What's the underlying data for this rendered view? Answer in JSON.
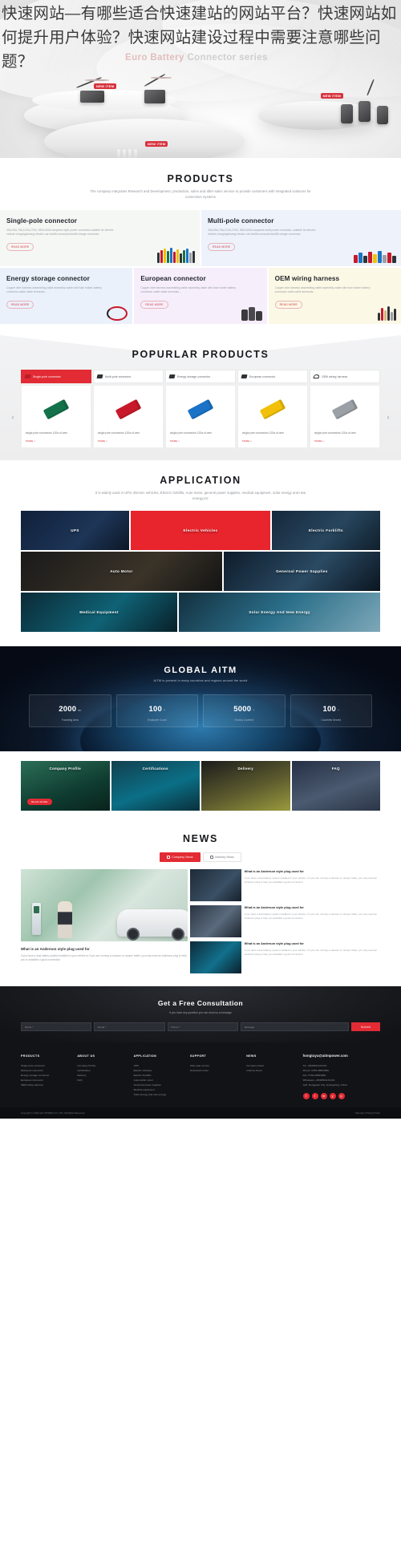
{
  "article": {
    "title": "快速网站—有哪些适合快速建站的网站平台？快速网站如何提升用户体验？快速网站建设过程中需要注意哪些问题？"
  },
  "hero": {
    "watermark_red": "Euro Battery",
    "watermark_grey": "Connector series",
    "tags": [
      "NEW ITEM",
      "NEW ITEM",
      "NEW ITEM",
      "NEW ITEM"
    ]
  },
  "products": {
    "title": "PRODUCTS",
    "subtitle": "The company integrates Research and Development, production, sales and after-sales service to provide customers with integrated solutions for connection systems",
    "cards": [
      {
        "title": "Single-pole connector",
        "desc": "30A,50A,75A,120A,175A, 350A,600A amperes style power connector suitable for electric vehicle charging/towing electric car forklift connector/forklift charge connector.",
        "button": "READ MORE",
        "bg": "#f5f7f4"
      },
      {
        "title": "Multi-pole connector",
        "desc": "30A,50A,75A,120A,175A, 350A,600A amperes multi power connector, suitable for electric vehicle charging/towing electric car forklift connector/forklift charge connector.",
        "button": "READ MORE",
        "bg": "#eef2fb"
      },
      {
        "title": "Energy storage connector",
        "desc": "Copper wire harness assembling cable assembly cable with fuse holder battery connector cable cable terminals...",
        "button": "READ MORE",
        "bg": "#eaf1fb"
      },
      {
        "title": "European connector",
        "desc": "Copper wire harness assembling cable assembly cable with fuse holder battery connector cable cable terminals...",
        "button": "READ MORE",
        "bg": "#f6eefb"
      },
      {
        "title": "OEM wiring harness",
        "desc": "Copper wire harness assembling cable assembly cable with fuse holder battery connector cable cable terminals...",
        "button": "READ MORE",
        "bg": "#fcf8e6"
      }
    ]
  },
  "popular": {
    "title": "POPURLAR PRODUCTS",
    "tabs": [
      {
        "label": "Single-pole connector",
        "active": true
      },
      {
        "label": "Multi-pole connector",
        "active": false
      },
      {
        "label": "Energy storage connector",
        "active": false
      },
      {
        "label": "European connector",
        "active": false
      },
      {
        "label": "OEM wiring harness",
        "active": false
      }
    ],
    "items": [
      {
        "caption": "single pole connectors 120a of oem",
        "more": "MORE >",
        "color": "#14724a"
      },
      {
        "caption": "single pole connectors 120a of oem",
        "more": "MORE >",
        "color": "#c8192a"
      },
      {
        "caption": "single pole connectors 120a of oem",
        "more": "MORE >",
        "color": "#1b73c7"
      },
      {
        "caption": "single pole connectors 120a of oem",
        "more": "MORE >",
        "color": "#f2c008"
      },
      {
        "caption": "single pole connectors 120a of oem",
        "more": "MORE >",
        "color": "#9aa0a6"
      }
    ],
    "prev_icon": "chevron-left",
    "next_icon": "chevron-right"
  },
  "application": {
    "title": "APPLICATION",
    "subtitle": "It is widely used in UPS, Electric vehicles, Electric forklifts, Auto motor, general power supplies, medical equipment, solar energy and new energy,etc",
    "tiles": [
      {
        "label": "UPS"
      },
      {
        "label": "Electric Vehicles"
      },
      {
        "label": "Electric Forklifts"
      },
      {
        "label": "Auto Motor"
      },
      {
        "label": "Genernal Power Supplies"
      },
      {
        "label": "Medical Equipment"
      },
      {
        "label": "Solar Energy And New Energy"
      }
    ]
  },
  "global": {
    "title": "GLOBAL AITM",
    "subtitle": "AITM is present in many countries and regions around the world",
    "stats": [
      {
        "num": "2000",
        "unit": "m²",
        "label": "Founding Area"
      },
      {
        "num": "100",
        "unit": "+",
        "label": "Employee Count"
      },
      {
        "num": "5000",
        "unit": "+",
        "label": "Factory Covered"
      },
      {
        "num": "100",
        "unit": "+",
        "label": "Countries Served"
      }
    ]
  },
  "about": {
    "cards": [
      {
        "label": "Company Profile",
        "button": "READ MORE"
      },
      {
        "label": "Certifications",
        "button": ""
      },
      {
        "label": "Delivery",
        "button": ""
      },
      {
        "label": "FAQ",
        "button": ""
      }
    ]
  },
  "news": {
    "title": "NEWS",
    "tabs": [
      {
        "label": "Company News",
        "active": true
      },
      {
        "label": "Industry News",
        "active": false
      }
    ],
    "feature": {
      "title": "What is an Anderson style plug used for",
      "desc": "If you have a dual battery system installed in your vehicle or if you are running a caravan or camper trailer, you may need an Anderson plug to help you to establish a good connection."
    },
    "items": [
      {
        "title": "What is an Anderson style plug used for",
        "desc": "If you have a dual battery system installed in your vehicle, or if you are running a caravan or camper trailer, you may need an Anderson plug to help you establish a good connection."
      },
      {
        "title": "What is an Anderson style plug used for",
        "desc": "If you have a dual battery system installed in your vehicle, or if you are running a caravan or camper trailer, you may need an Anderson plug to help you establish a good connection."
      },
      {
        "title": "What is an Anderson style plug used for",
        "desc": "If you have a dual battery system installed in your vehicle, or if you are running a caravan or camper trailer, you may need an Anderson plug to help you establish a good connection."
      }
    ]
  },
  "consult": {
    "title": "Get a Free Consultation",
    "subtitle": "If you have any question you can send us a message",
    "fields": [
      {
        "placeholder": "Name *"
      },
      {
        "placeholder": "Email *"
      },
      {
        "placeholder": "Phone *"
      },
      {
        "placeholder": "Message"
      }
    ],
    "submit": "Submit"
  },
  "footer": {
    "columns": [
      {
        "heading": "PRODUCTS",
        "links": [
          "Single-pole connector",
          "Multi-pole connector",
          "Energy storage connector",
          "European connector",
          "OEM wiring harness"
        ]
      },
      {
        "heading": "ABOUT US",
        "links": [
          "Company Profile",
          "Certification",
          "Delivery",
          "FAQ"
        ]
      },
      {
        "heading": "APPLICATION",
        "links": [
          "UPS",
          "Electric Vehicles",
          "Electric Forklifts",
          "Automobile motor",
          "Genernal power supplies",
          "Medical equipment",
          "Solar energy and new energy"
        ]
      },
      {
        "heading": "SUPPORT",
        "links": [
          "After-sale service",
          "Download center"
        ]
      },
      {
        "heading": "NEWS",
        "links": [
          "Company News",
          "Industry News"
        ]
      }
    ],
    "contact": {
      "email": "hongtuyu@aitmpower.com",
      "lines": [
        "Tel: +8618814141431",
        "Phone: 0769-38834566",
        "Fax: 0769-38834866",
        "Whatsapp: +8618814141431",
        "Add: Dongguan City, Guangdong, China"
      ]
    },
    "socials": [
      "f",
      "t",
      "in",
      "y",
      "p"
    ],
    "copyright": "Copyright © 2024 aitm POWER CO.,LTD. All Rights Reserved.",
    "copyright_right": "Sitemap | Privacy Policy"
  },
  "colors": {
    "accent": "#e22b34",
    "dark": "#111317",
    "muted": "#9aa0a6"
  }
}
